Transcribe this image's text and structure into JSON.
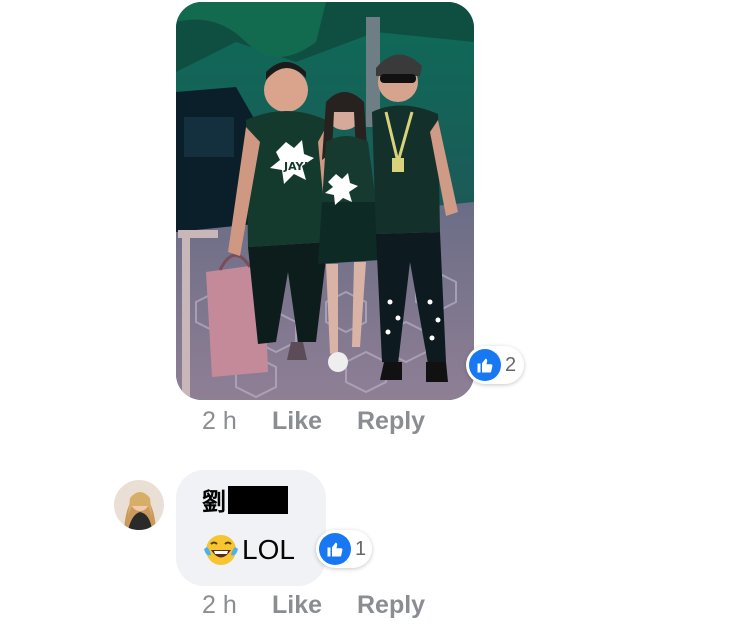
{
  "comments": [
    {
      "type": "photo",
      "photo_alt": "Three people standing together in a parking garage",
      "shirt_text": "JAY!",
      "reactions": {
        "icon": "like-icon",
        "count": "2"
      },
      "time": "2 h",
      "like_label": "Like",
      "reply_label": "Reply"
    },
    {
      "type": "text",
      "author": "劉",
      "author_redacted": true,
      "text": "LOL",
      "emoji": "laughing-tears-emoji",
      "reactions": {
        "icon": "like-icon",
        "count": "1"
      },
      "time": "2 h",
      "like_label": "Like",
      "reply_label": "Reply"
    }
  ],
  "colors": {
    "like_blue": "#1877f2",
    "meta_gray": "#8a8d91",
    "bubble_bg": "#f0f2f5",
    "text_dark": "#050505"
  }
}
